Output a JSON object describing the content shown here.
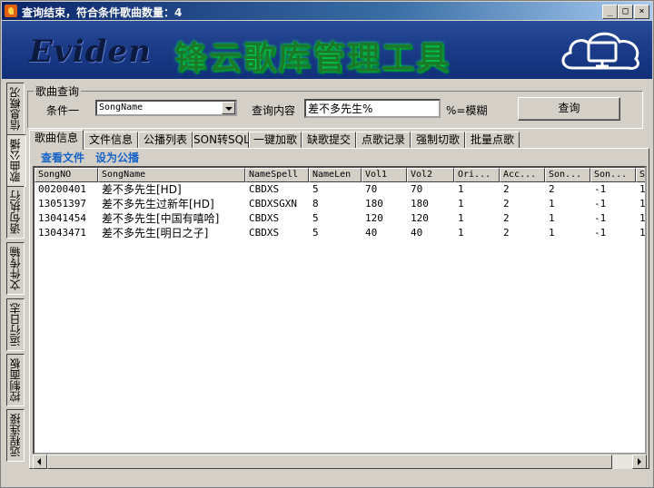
{
  "window": {
    "title": "查询结束，符合条件歌曲数量：4"
  },
  "banner": {
    "logo": "Eviden",
    "product": "锋云歌库管理工具"
  },
  "side_tabs": [
    "信息概况",
    "歌曲公播",
    "语句执行",
    "文件传输",
    "运行日志",
    "控制面板",
    "远程连接"
  ],
  "query": {
    "group_title": "歌曲查询",
    "condition_label": "条件一",
    "condition_value": "SongName",
    "content_label": "查询内容",
    "content_value": "差不多先生%",
    "hint": "%=模糊",
    "button": "查询"
  },
  "tabs": [
    "歌曲信息",
    "文件信息",
    "公播列表",
    "SON转SQL",
    "一键加歌",
    "缺歌提交",
    "点歌记录",
    "强制切歌",
    "批量点歌"
  ],
  "actions": [
    "查看文件",
    "设为公播"
  ],
  "table": {
    "columns": [
      "SongNO",
      "SongName",
      "NameSpell",
      "NameLen",
      "Vol1",
      "Vol2",
      "Ori...",
      "Acc...",
      "Son...",
      "Son...",
      "S"
    ],
    "rows": [
      [
        "00200401",
        "差不多先生[HD]",
        "CBDXS",
        "5",
        "70",
        "70",
        "1",
        "2",
        "2",
        "-1",
        "1"
      ],
      [
        "13051397",
        "差不多先生过新年[HD]",
        "CBDXSGXN",
        "8",
        "180",
        "180",
        "1",
        "2",
        "1",
        "-1",
        "1"
      ],
      [
        "13041454",
        "差不多先生[中国有嘻哈]",
        "CBDXS",
        "5",
        "120",
        "120",
        "1",
        "2",
        "1",
        "-1",
        "1"
      ],
      [
        "13043471",
        "差不多先生[明日之子]",
        "CBDXS",
        "5",
        "40",
        "40",
        "1",
        "2",
        "1",
        "-1",
        "1"
      ]
    ]
  },
  "icons": {
    "app": "app-flame-icon",
    "monitor": "cloud-monitor-icon"
  }
}
